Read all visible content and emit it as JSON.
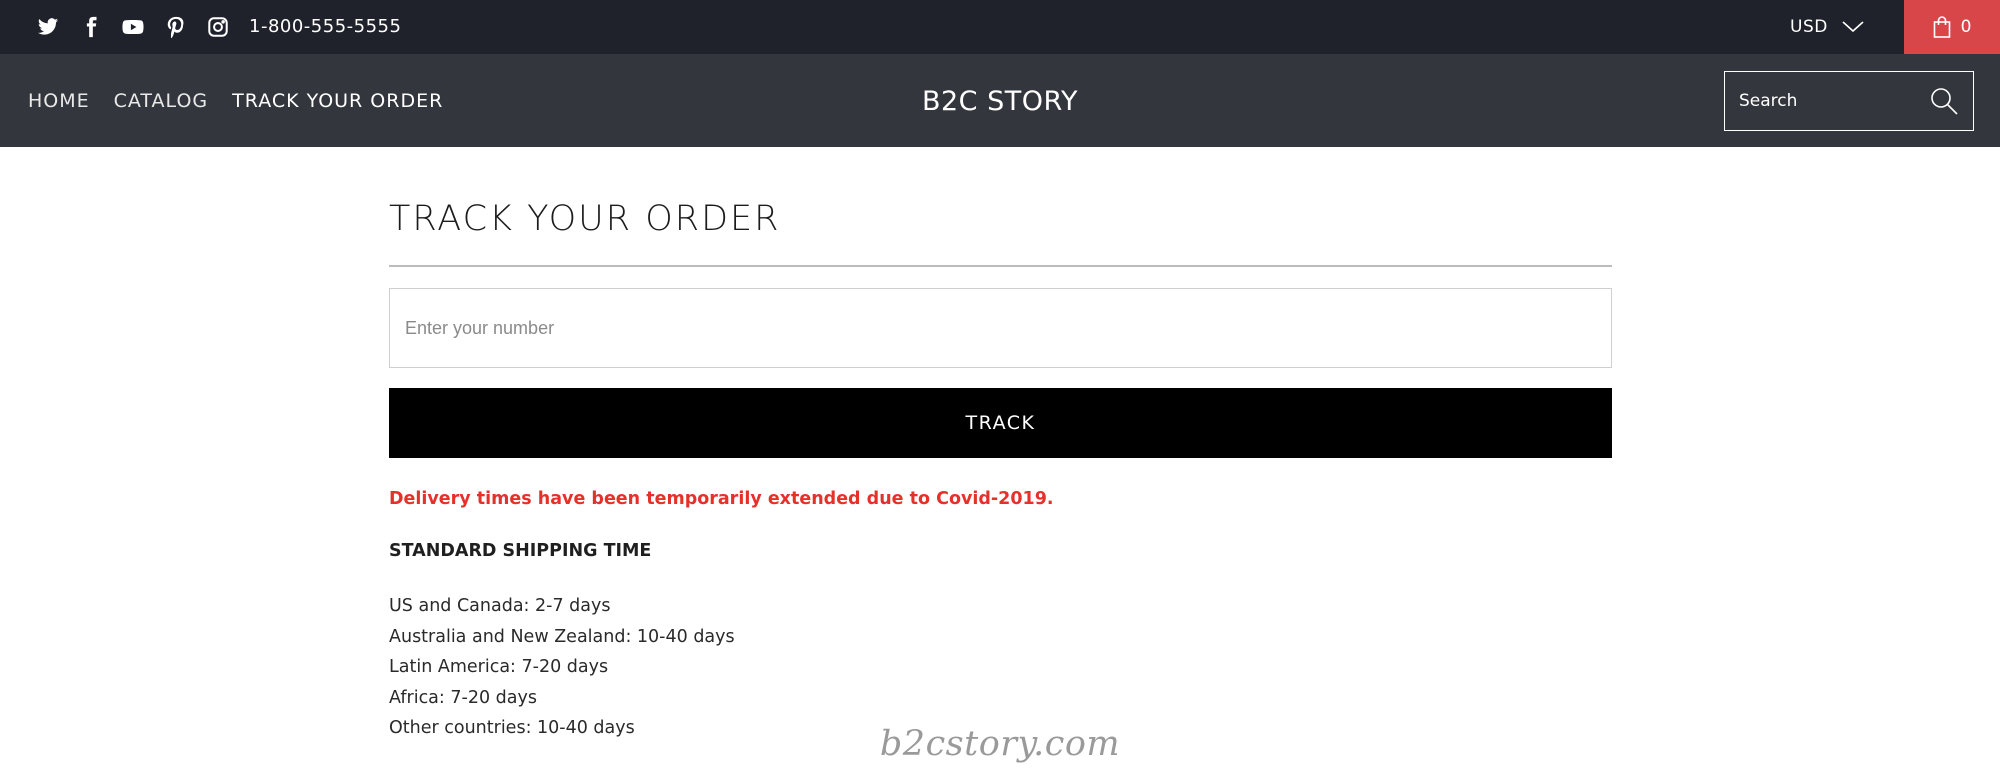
{
  "topbar": {
    "social_icons": [
      "twitter-icon",
      "facebook-icon",
      "youtube-icon",
      "pinterest-icon",
      "instagram-icon"
    ],
    "phone": "1-800-555-5555",
    "currency": "USD",
    "cart_count": "0"
  },
  "nav": {
    "links": [
      {
        "label": "HOME"
      },
      {
        "label": "CATALOG"
      },
      {
        "label": "TRACK YOUR ORDER",
        "active": true
      }
    ],
    "logo": "B2C STORY",
    "search_placeholder": "Search"
  },
  "main": {
    "title": "TRACK YOUR ORDER",
    "order_placeholder": "Enter your number",
    "track_label": "TRACK",
    "notice": "Delivery times have been temporarily extended due to Covid-2019.",
    "shipping_heading": "STANDARD SHIPPING TIME",
    "shipping_times": [
      "US and Canada: 2-7 days",
      "Australia and New Zealand: 10-40 days",
      "Latin America: 7-20 days",
      "Africa: 7-20 days",
      "Other countries: 10-40 days"
    ]
  },
  "watermark": "b2cstory.com",
  "colors": {
    "topbar_bg": "#1f222a",
    "navbar_bg": "#33363c",
    "cart_bg": "#d9464a",
    "notice_text": "#e6312a",
    "button_bg": "#000000"
  }
}
